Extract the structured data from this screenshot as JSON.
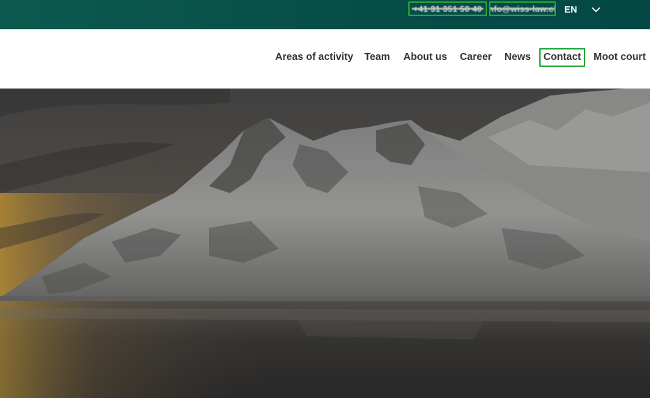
{
  "topbar": {
    "phone": "+41 31 351 50 40",
    "email": "info@wiss-law.ch",
    "language": "EN",
    "language_chevron_icon": "chevron-down-icon",
    "background_color": "#064c47",
    "highlight_color": "#22a83a"
  },
  "nav": {
    "items": [
      {
        "label": "Areas of activity"
      },
      {
        "label": "Team"
      },
      {
        "label": "About us"
      },
      {
        "label": "Career"
      },
      {
        "label": "News"
      },
      {
        "label": "Contact"
      },
      {
        "label": "Moot court"
      }
    ]
  },
  "hero": {
    "image": "snow-covered-mountain-over-lake-at-dusk"
  }
}
